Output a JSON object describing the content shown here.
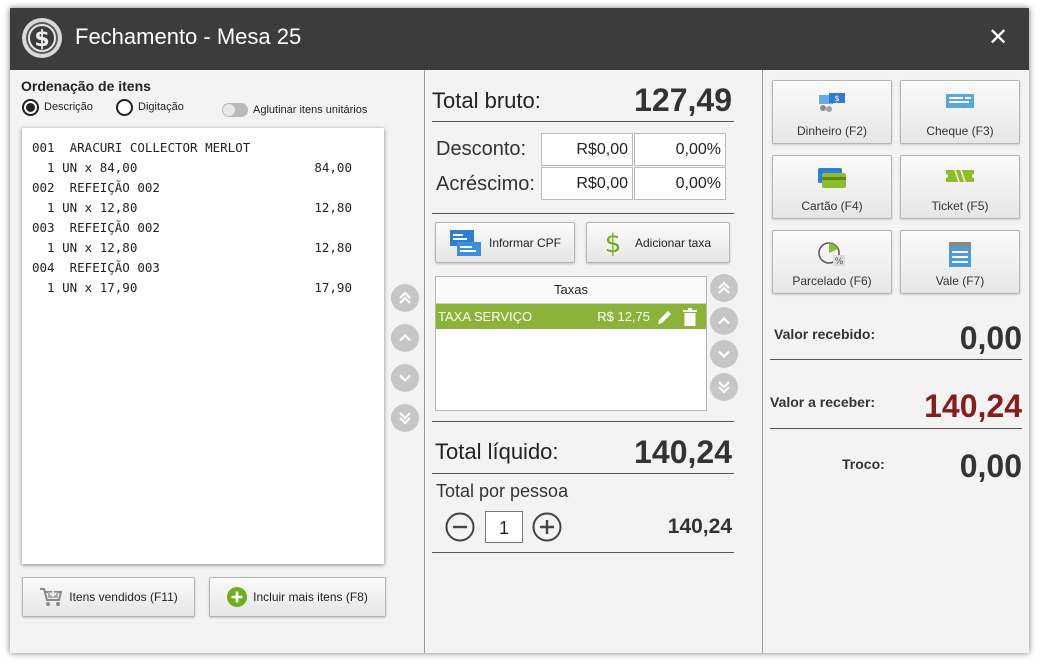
{
  "window": {
    "title": "Fechamento - Mesa 25",
    "close_label": "✕"
  },
  "left": {
    "section_title": "Ordenação de itens",
    "radio_descricao": "Descrição",
    "radio_digitacao": "Digitação",
    "toggle_label": "Aglutinar itens unitários",
    "items": [
      {
        "line1": "001  ARACURI COLLECTOR MERLOT",
        "line2": "  1 UN x 84,00",
        "total": "84,00"
      },
      {
        "line1": "002  REFEIÇÃO 002",
        "line2": "  1 UN x 12,80",
        "total": "12,80"
      },
      {
        "line1": "003  REFEIÇÃO 002",
        "line2": "  1 UN x 12,80",
        "total": "12,80"
      },
      {
        "line1": "004  REFEIÇÃO 003",
        "line2": "  1 UN x 17,90",
        "total": "17,90"
      }
    ],
    "btn_itens_vendidos": "Itens vendidos (F11)",
    "btn_incluir": "Incluir mais itens (F8)"
  },
  "middle": {
    "total_bruto_label": "Total bruto:",
    "total_bruto_value": "127,49",
    "desconto_label": "Desconto:",
    "desconto_valor": "R$0,00",
    "desconto_pct": "0,00%",
    "acrescimo_label": "Acréscimo:",
    "acrescimo_valor": "R$0,00",
    "acrescimo_pct": "0,00%",
    "btn_cpf": "Informar CPF",
    "btn_taxa": "Adicionar taxa",
    "taxes_header": "Taxas",
    "tax_name": "TAXA SERVIÇO",
    "tax_value": "R$ 12,75",
    "total_liquido_label": "Total líquido:",
    "total_liquido_value": "140,24",
    "por_pessoa_label": "Total por pessoa",
    "qty": "1",
    "por_pessoa_value": "140,24"
  },
  "right": {
    "payments": [
      {
        "label": "Dinheiro (F2)",
        "icon": "money-icon"
      },
      {
        "label": "Cheque (F3)",
        "icon": "cheque-icon"
      },
      {
        "label": "Cartão (F4)",
        "icon": "card-icon"
      },
      {
        "label": "Ticket (F5)",
        "icon": "ticket-icon"
      },
      {
        "label": "Parcelado (F6)",
        "icon": "installment-icon"
      },
      {
        "label": "Vale (F7)",
        "icon": "voucher-icon"
      }
    ],
    "valor_recebido_label": "Valor recebido:",
    "valor_recebido_value": "0,00",
    "valor_receber_label": "Valor a receber:",
    "valor_receber_value": "140,24",
    "troco_label": "Troco:",
    "troco_value": "0,00"
  },
  "colors": {
    "accent_green": "#8bb33a",
    "due_red": "#8b1a1a",
    "titlebar": "#3c3c3c"
  }
}
